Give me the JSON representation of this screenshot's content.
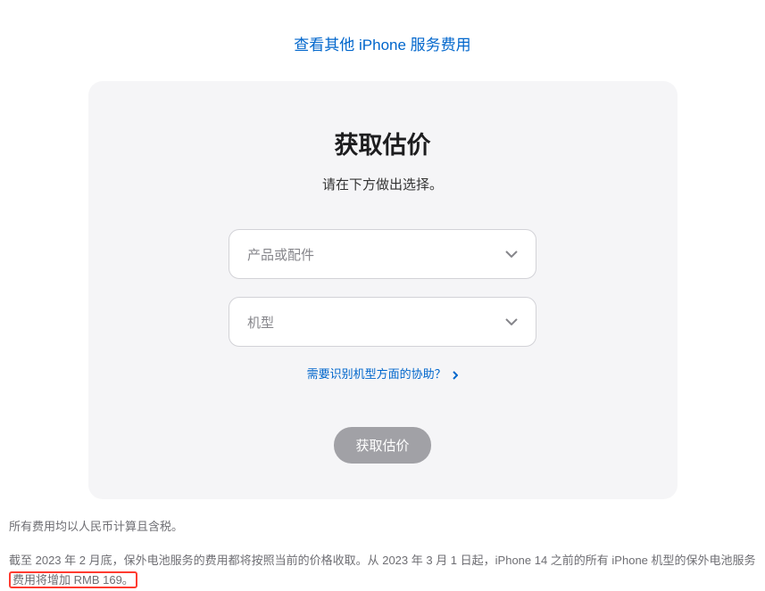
{
  "top_link": {
    "label": "查看其他 iPhone 服务费用"
  },
  "card": {
    "title": "获取估价",
    "subtitle": "请在下方做出选择。",
    "dropdown1": {
      "placeholder": "产品或配件"
    },
    "dropdown2": {
      "placeholder": "机型"
    },
    "help_link": "需要识别机型方面的协助？",
    "submit_label": "获取估价"
  },
  "footer": {
    "line1": "所有费用均以人民币计算且含税。",
    "line2_part1": "截至 2023 年 2 月底，保外电池服务的费用都将按照当前的价格收取。从 2023 年 3 月 1 日起，iPhone 14 之前的所有 iPhone 机型的保外电池服务",
    "line2_highlight": "费用将增加 RMB 169。"
  }
}
